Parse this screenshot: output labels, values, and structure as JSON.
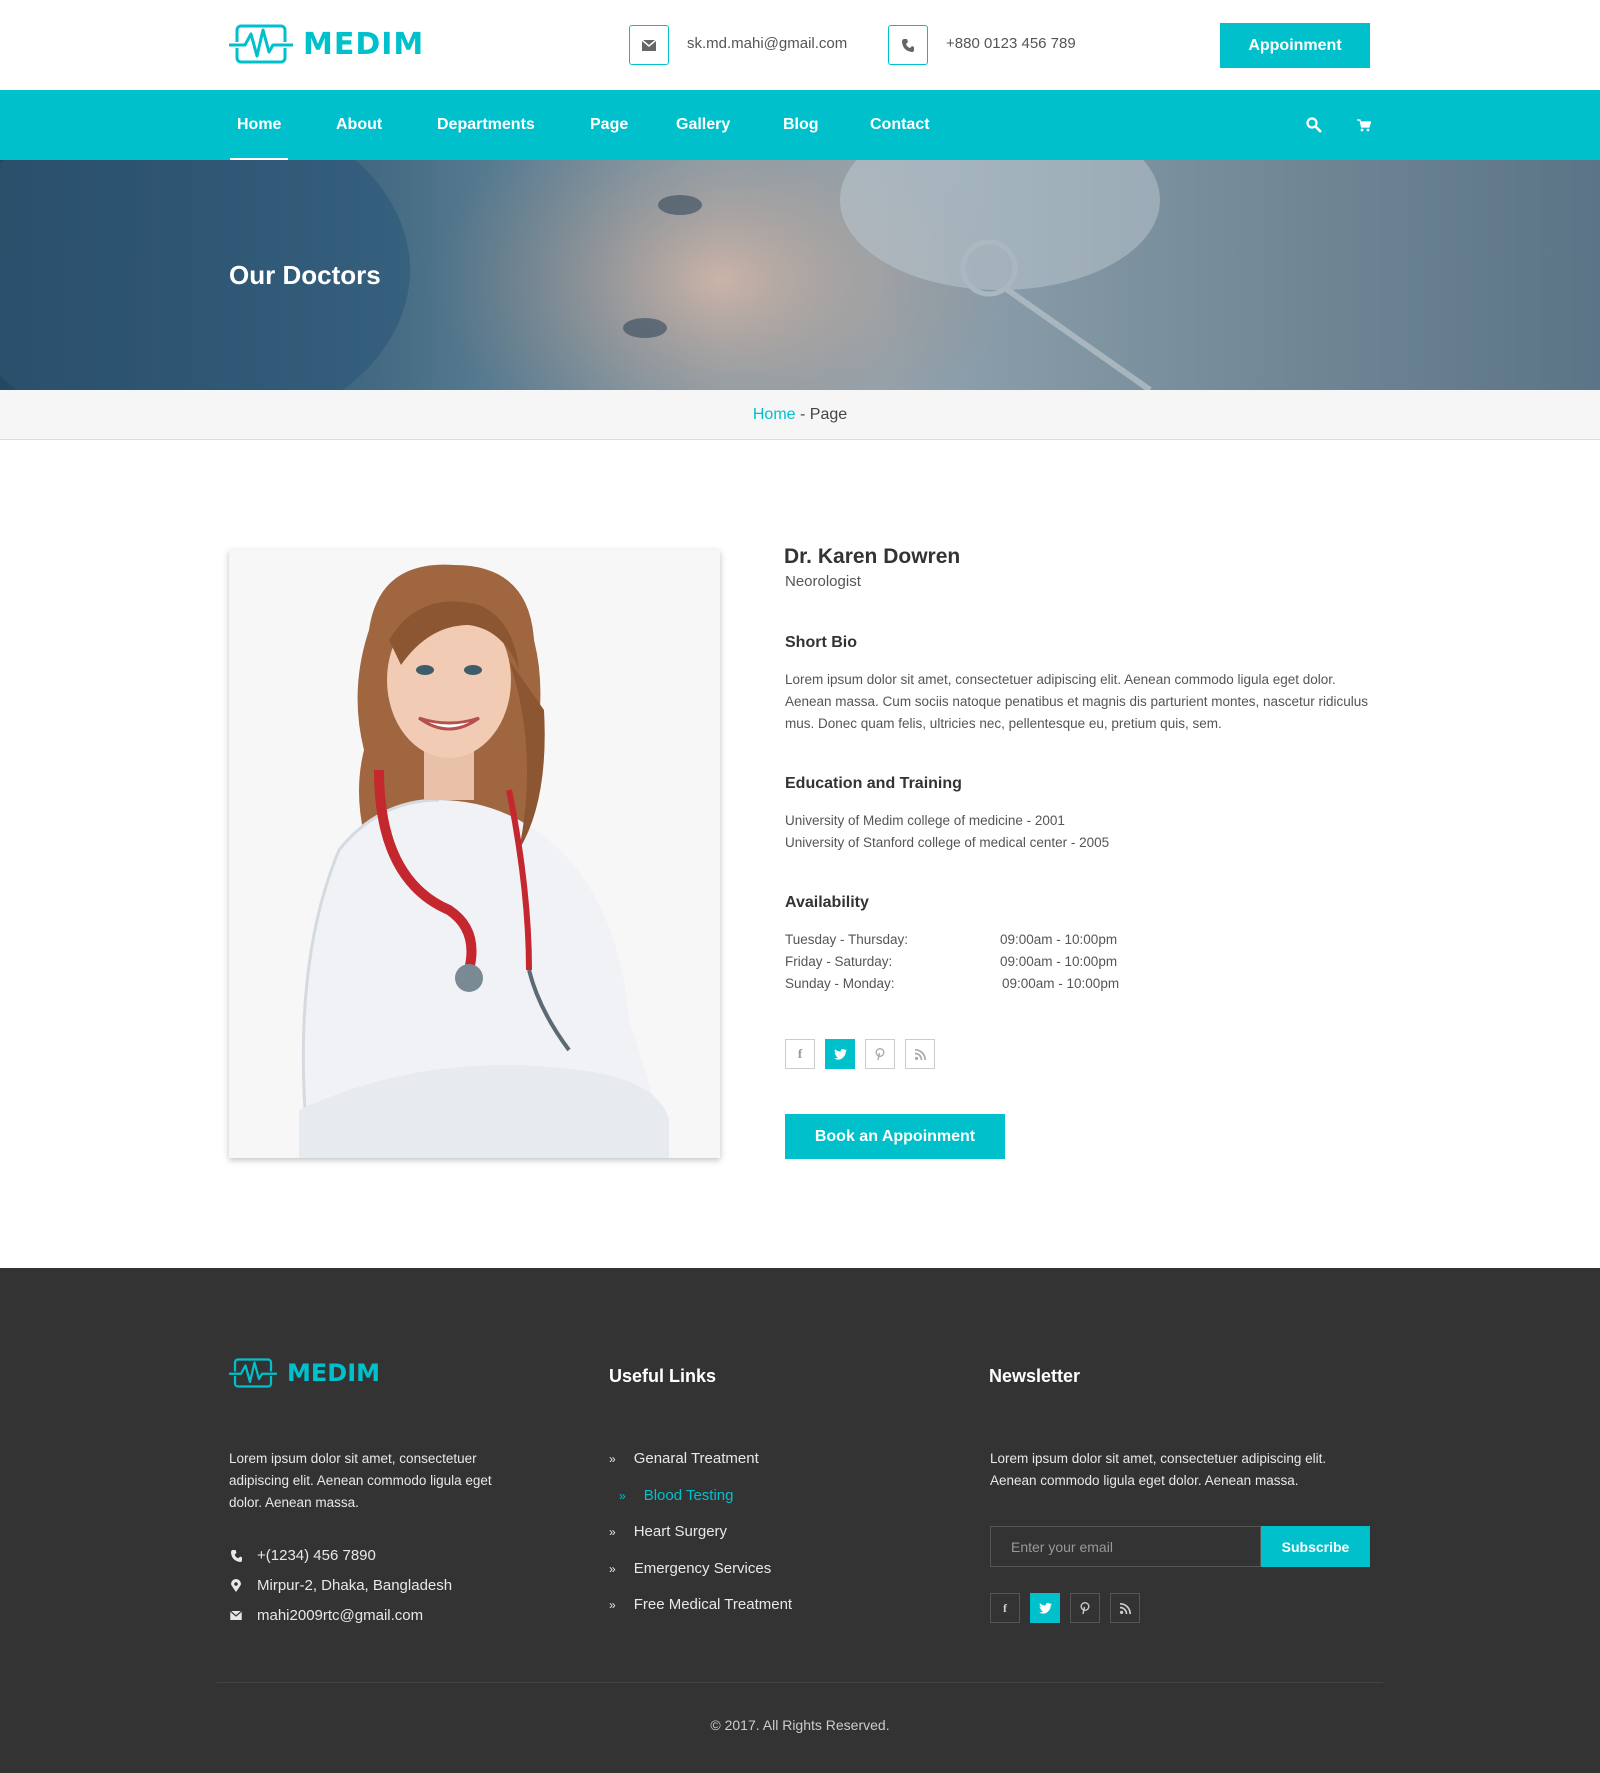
{
  "brand": {
    "name": "MEDIM",
    "accent": "#00c1cb"
  },
  "topbar": {
    "email": "sk.md.mahi@gmail.com",
    "phone": "+880 0123 456 789",
    "appointment_label": "Appoinment",
    "email_icon": "envelope-icon",
    "phone_icon": "phone-icon"
  },
  "nav": {
    "items": [
      {
        "label": "Home"
      },
      {
        "label": "About"
      },
      {
        "label": "Departments"
      },
      {
        "label": "Page"
      },
      {
        "label": "Gallery"
      },
      {
        "label": "Blog"
      },
      {
        "label": "Contact"
      }
    ],
    "active": "Home",
    "icons": [
      "search-icon",
      "cart-icon"
    ]
  },
  "hero": {
    "title": "Our Doctors"
  },
  "breadcrumb": {
    "home": "Home",
    "separator": " - ",
    "current": "Page"
  },
  "doctor": {
    "name": "Dr. Karen Dowren",
    "role": "Neorologist",
    "bio_heading": "Short Bio",
    "bio_lines": [
      "Lorem ipsum dolor sit amet, consectetuer adipiscing elit. Aenean commodo ligula eget dolor.",
      "Aenean massa. Cum sociis natoque penatibus et magnis dis parturient montes, nascetur ridiculus",
      "mus. Donec quam felis, ultricies nec, pellentesque eu, pretium quis, sem."
    ],
    "education_heading": "Education and Training",
    "education": [
      "University of Medim college of medicine - 2001",
      "University of Stanford college of medical center - 2005"
    ],
    "availability_heading": "Availability",
    "availability": [
      {
        "days": "Tuesday - Thursday:",
        "time": "09:00am - 10:00pm"
      },
      {
        "days": "Friday - Saturday:",
        "time": "09:00am - 10:00pm"
      },
      {
        "days": "Sunday - Monday:",
        "time": "09:00am - 10:00pm"
      }
    ],
    "social": [
      {
        "icon": "facebook-icon",
        "glyph": "f",
        "active": false
      },
      {
        "icon": "twitter-icon",
        "glyph": "t",
        "active": true
      },
      {
        "icon": "pinterest-icon",
        "glyph": "p",
        "active": false
      },
      {
        "icon": "rss-icon",
        "glyph": "rss",
        "active": false
      }
    ],
    "book_label": "Book an Appoinment"
  },
  "footer": {
    "about_lines": [
      "Lorem ipsum dolor sit amet, consectetuer",
      "adipiscing elit. Aenean commodo ligula eget",
      "dolor. Aenean massa."
    ],
    "contact": {
      "phone": "+(1234) 456 7890",
      "address": "Mirpur-2, Dhaka, Bangladesh",
      "email": "mahi2009rtc@gmail.com"
    },
    "links_heading": "Useful Links",
    "links": [
      {
        "label": "Genaral Treatment",
        "active": false
      },
      {
        "label": "Blood Testing",
        "active": true
      },
      {
        "label": "Heart Surgery",
        "active": false
      },
      {
        "label": "Emergency Services",
        "active": false
      },
      {
        "label": "Free Medical Treatment",
        "active": false
      }
    ],
    "newsletter_heading": "Newsletter",
    "newsletter_lines": [
      "Lorem ipsum dolor sit amet, consectetuer adipiscing elit.",
      "Aenean commodo ligula eget dolor. Aenean massa."
    ],
    "email_placeholder": "Enter your email",
    "subscribe_label": "Subscribe",
    "copyright": "© 2017. All Rights Reserved."
  }
}
